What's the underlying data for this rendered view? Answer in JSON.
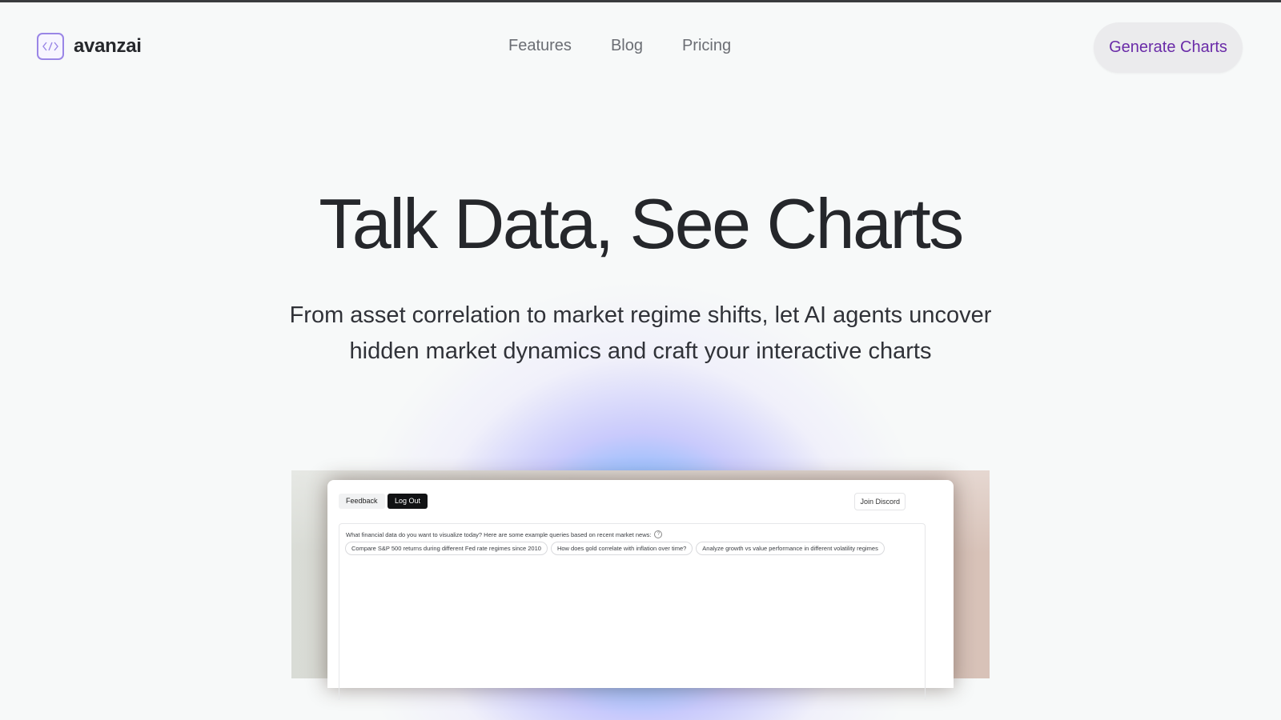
{
  "header": {
    "logo_text": "avanzai",
    "nav": [
      {
        "label": "Features"
      },
      {
        "label": "Blog"
      },
      {
        "label": "Pricing"
      }
    ],
    "cta_label": "Generate Charts"
  },
  "hero": {
    "title": "Talk Data, See Charts",
    "subtitle_line1": "From asset correlation to market regime shifts, let AI agents uncover",
    "subtitle_line2": "hidden market dynamics and craft your interactive charts"
  },
  "preview": {
    "feedback_label": "Feedback",
    "logout_label": "Log Out",
    "discord_label": "Join Discord",
    "prompt": "What financial data do you want to visualize today? Here are some example queries based on recent market news:",
    "examples": [
      "Compare S&P 500 returns during different Fed rate regimes since 2010",
      "How does gold correlate with inflation over time?",
      "Analyze growth vs value performance in different volatility regimes"
    ]
  },
  "colors": {
    "background": "#f7f9f9",
    "brand_accent": "#9a86e6",
    "cta_text": "#6a2ba8",
    "cta_bg": "#ebebed",
    "glow": "#20b4ff"
  },
  "icons": {
    "logo": "code-brackets-icon",
    "help": "help-circle-icon"
  }
}
